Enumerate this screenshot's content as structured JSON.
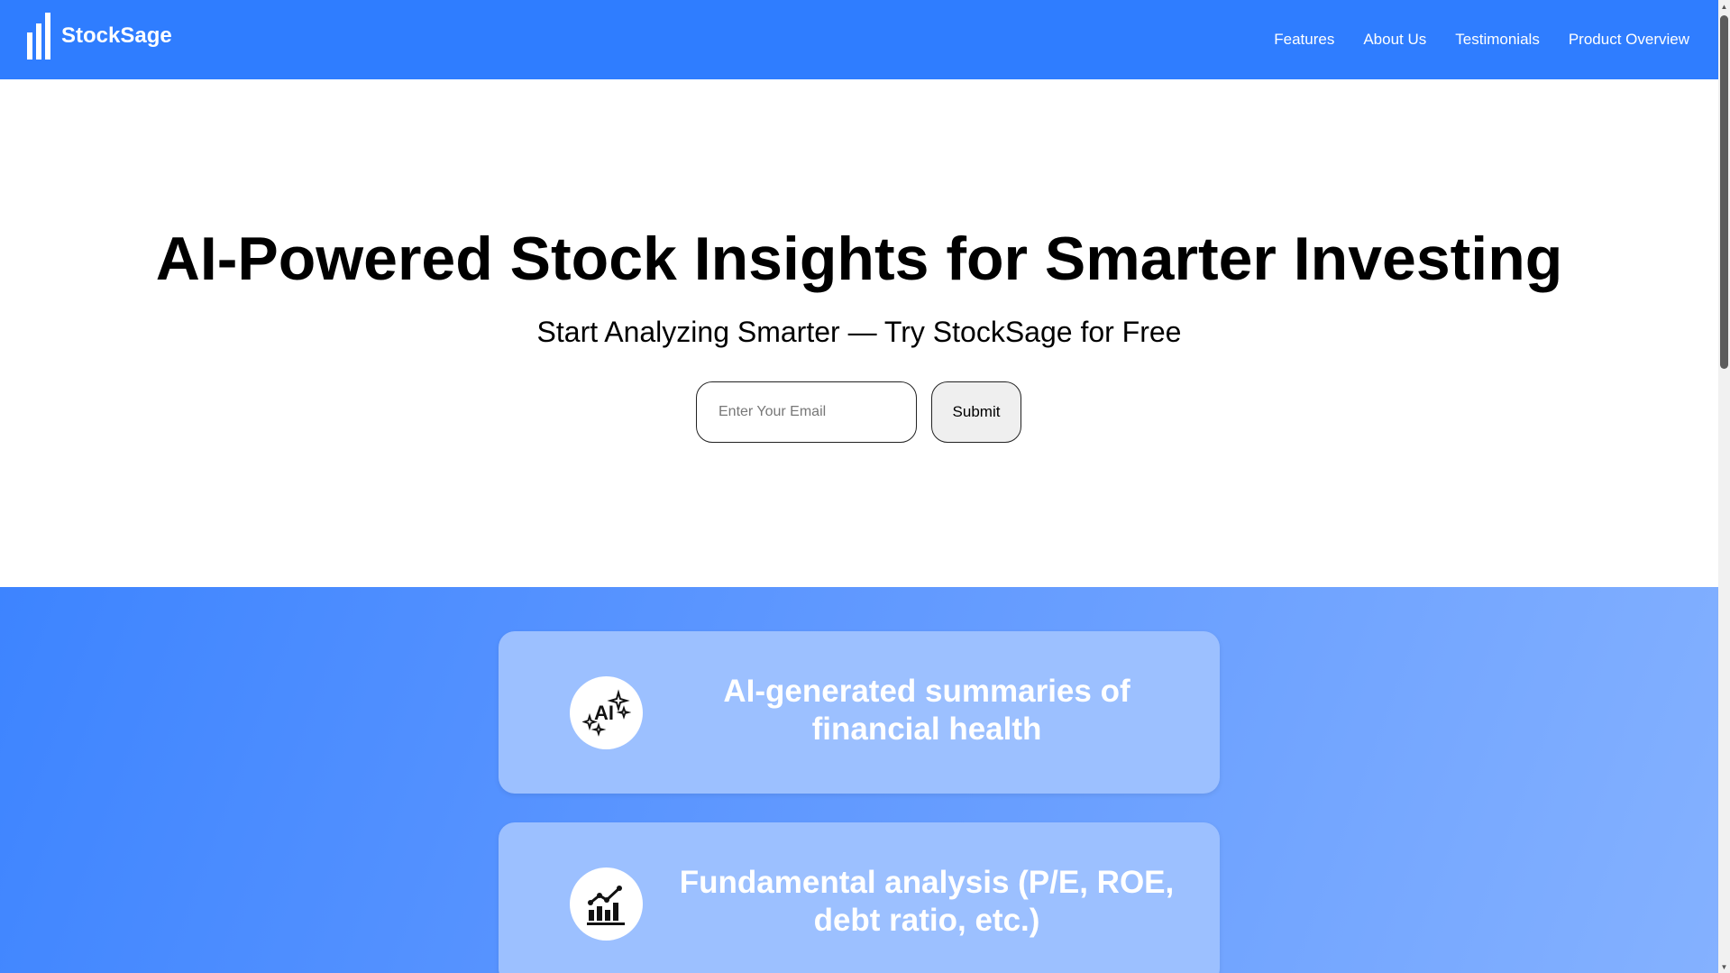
{
  "header": {
    "brand": "StockSage",
    "logo_icon": "bar-chart-logo-icon",
    "nav": [
      "Features",
      "About Us",
      "Testimonials",
      "Product Overview"
    ]
  },
  "hero": {
    "title": "AI-Powered Stock Insights for Smarter Investing",
    "subtitle": "Start Analyzing Smarter — Try StockSage for Free",
    "email_placeholder": "Enter Your Email",
    "email_value": "",
    "submit_label": "Submit"
  },
  "features": [
    {
      "icon": "ai-sparkles-icon",
      "text": "AI-generated summaries of financial health"
    },
    {
      "icon": "growth-chart-icon",
      "text": "Fundamental analysis (P/E, ROE, debt ratio, etc.)"
    }
  ],
  "colors": {
    "primary": "#2f7dff",
    "card": "#9cc0ff",
    "text_dark": "#000000",
    "text_light": "#ffffff"
  }
}
